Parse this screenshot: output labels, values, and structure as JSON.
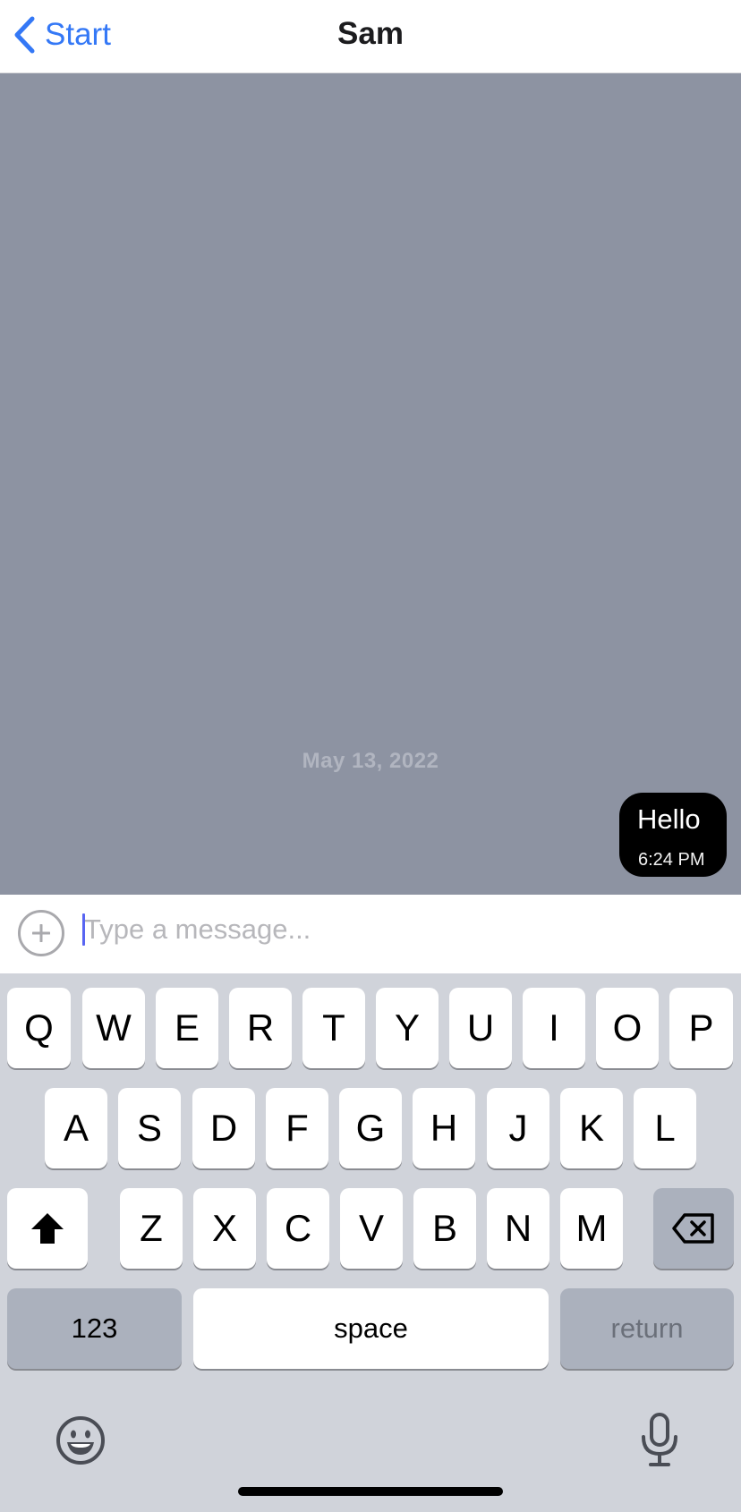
{
  "nav": {
    "back_label": "Start",
    "title": "Sam"
  },
  "chat": {
    "date_divider": "May 13, 2022",
    "messages": [
      {
        "text": "Hello",
        "time": "6:24 PM",
        "direction": "outgoing"
      }
    ]
  },
  "composer": {
    "placeholder": "Type a message...",
    "value": ""
  },
  "keyboard": {
    "row1": [
      "Q",
      "W",
      "E",
      "R",
      "T",
      "Y",
      "U",
      "I",
      "O",
      "P"
    ],
    "row2": [
      "A",
      "S",
      "D",
      "F",
      "G",
      "H",
      "J",
      "K",
      "L"
    ],
    "row3": [
      "Z",
      "X",
      "C",
      "V",
      "B",
      "N",
      "M"
    ],
    "numbers_label": "123",
    "space_label": "space",
    "return_label": "return"
  },
  "icons": [
    "chevron-left-icon",
    "plus-icon",
    "shift-icon",
    "delete-icon",
    "emoji-icon",
    "microphone-icon"
  ],
  "colors": {
    "accent": "#3478f6",
    "chat_background": "#8d93a2",
    "bubble": "#000000",
    "keyboard_background": "#d0d3da",
    "caret": "#5865f2"
  }
}
